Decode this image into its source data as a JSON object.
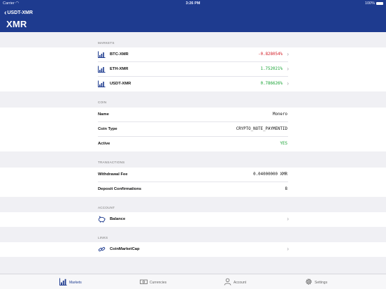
{
  "status": {
    "carrier": "Carrier",
    "time": "3:26 PM",
    "battery": "100%"
  },
  "nav": {
    "back_label": "USDT-XMR",
    "title": "XMR"
  },
  "markets": {
    "header": "MARKETS",
    "items": [
      {
        "label": "BTC-XMR",
        "value": "-0.828054%"
      },
      {
        "label": "ETH-XMR",
        "value": "1.752021%"
      },
      {
        "label": "USDT-XMR",
        "value": "0.786626%"
      }
    ]
  },
  "coin": {
    "header": "COIN",
    "rows": [
      {
        "label": "Name",
        "value": "Monero"
      },
      {
        "label": "Coin Type",
        "value": "CRYPTO_NOTE_PAYMENTID"
      },
      {
        "label": "Active",
        "value": "YES"
      }
    ]
  },
  "transactions": {
    "header": "TRANSACTIONS",
    "rows": [
      {
        "label": "Withdrawal Fee",
        "value": "0.04000000 XMR"
      },
      {
        "label": "Deposit Confirmations",
        "value": "8"
      }
    ]
  },
  "account": {
    "header": "ACCOUNT",
    "balance_label": "Balance"
  },
  "links": {
    "header": "LINKS",
    "coinmarketcap_label": "CoinMarketCap"
  },
  "tabs": [
    {
      "label": "Markets",
      "icon": "bar-chart-icon"
    },
    {
      "label": "Currencies",
      "icon": "banknote-icon"
    },
    {
      "label": "Account",
      "icon": "person-icon"
    },
    {
      "label": "Settings",
      "icon": "gear-icon"
    }
  ],
  "colors": {
    "header": "#1e3b8f",
    "negative": "#d21b24",
    "positive": "#17a233",
    "active_tab": "#1e3b8f"
  }
}
